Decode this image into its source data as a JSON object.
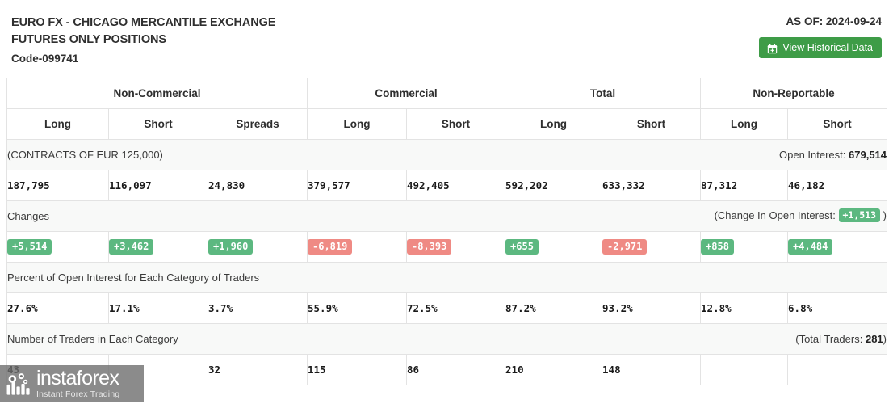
{
  "header": {
    "title_line1": "EURO FX - CHICAGO MERCANTILE EXCHANGE",
    "title_line2": "FUTURES ONLY POSITIONS",
    "code": "Code-099741",
    "as_of": "AS OF: 2024-09-24",
    "history_button": "View Historical Data",
    "history_button_icon": "calendar-plus-icon",
    "button_color": "#3e9c47"
  },
  "table": {
    "groups": [
      {
        "label": "Non-Commercial",
        "span": 3
      },
      {
        "label": "Commercial",
        "span": 2
      },
      {
        "label": "Total",
        "span": 2
      },
      {
        "label": "Non-Reportable",
        "span": 2
      }
    ],
    "subheaders": [
      "Long",
      "Short",
      "Spreads",
      "Long",
      "Short",
      "Long",
      "Short",
      "Long",
      "Short"
    ],
    "contracts_label": "(CONTRACTS OF EUR 125,000)",
    "open_interest_label": "Open Interest:",
    "open_interest_value": "679,514",
    "positions": [
      "187,795",
      "116,097",
      "24,830",
      "379,577",
      "492,405",
      "592,202",
      "633,332",
      "87,312",
      "46,182"
    ],
    "changes_label": "Changes",
    "change_oi_prefix": "(Change In Open Interest:",
    "change_oi_value": "+1,513",
    "change_oi_suffix": ")",
    "changes": [
      {
        "value": "+5,514",
        "sign": "pos"
      },
      {
        "value": "+3,462",
        "sign": "pos"
      },
      {
        "value": "+1,960",
        "sign": "pos"
      },
      {
        "value": "-6,819",
        "sign": "neg"
      },
      {
        "value": "-8,393",
        "sign": "neg"
      },
      {
        "value": "+655",
        "sign": "pos"
      },
      {
        "value": "-2,971",
        "sign": "neg"
      },
      {
        "value": "+858",
        "sign": "pos"
      },
      {
        "value": "+4,484",
        "sign": "pos"
      }
    ],
    "percent_label": "Percent of Open Interest for Each Category of Traders",
    "percents": [
      "27.6%",
      "17.1%",
      "3.7%",
      "55.9%",
      "72.5%",
      "87.2%",
      "93.2%",
      "12.8%",
      "6.8%"
    ],
    "traders_label": "Number of Traders in Each Category",
    "total_traders_prefix": "(Total Traders:",
    "total_traders_value": "281",
    "total_traders_suffix": ")",
    "traders": [
      "43",
      "",
      "32",
      "115",
      "86",
      "210",
      "148",
      "",
      ""
    ],
    "colors": {
      "positive": "#5cb880",
      "negative": "#ef8a84",
      "row_tint": "#f8f9f8",
      "border": "#e3e3e3"
    }
  },
  "watermark": {
    "name": "instaforex",
    "tagline": "Instant Forex Trading"
  }
}
